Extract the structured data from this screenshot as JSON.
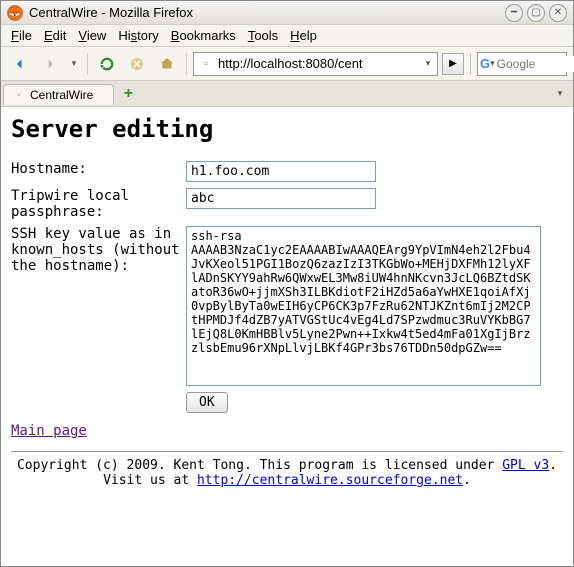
{
  "window": {
    "title": "CentralWire - Mozilla Firefox"
  },
  "menu": {
    "file": "File",
    "edit": "Edit",
    "view": "View",
    "history": "History",
    "bookmarks": "Bookmarks",
    "tools": "Tools",
    "help": "Help"
  },
  "url": {
    "value": "http://localhost:8080/cent"
  },
  "search": {
    "placeholder": "Google"
  },
  "tab": {
    "label": "CentralWire"
  },
  "page": {
    "heading": "Server editing",
    "hostname_label": "Hostname:",
    "hostname_value": "h1.foo.com",
    "passphrase_label": "Tripwire local passphrase:",
    "passphrase_value": "abc",
    "sshkey_label": "SSH key value as in known_hosts (without the hostname):",
    "sshkey_value": "ssh-rsa AAAAB3NzaC1yc2EAAAABIwAAAQEArg9YpVImN4eh2l2Fbu4JvKXeol51PGI1BozQ6zazIzI3TKGbWo+MEHjDXFMh12lyXFlADnSKYY9ahRw6QWxwEL3Mw8iUW4hnNKcvn3JcLQ6BZtdSKatoR36wO+jjmXSh3ILBKdiotF2iHZd5a6aYwHXE1qoiAfXj0vpBylByTa0wEIH6yCP6CK3p7FzRu62NTJKZnt6mIj2M2CPtHPMDJf4dZB7yATVGStUc4vEg4Ld7SPzwdmuc3RuVYKbBG7lEjQ8L0KmHBBlv5Lyne2Pwn++Ixkw4t5ed4mFa01XgIjBrzzlsbEmu96rXNpLlvjLBKf4GPr3bs76TDDn50dpGZw==",
    "ok_label": "OK",
    "mainpage_link": "Main page",
    "copyright_pre": "Copyright (c) 2009. Kent Tong. This program is licensed under ",
    "gpl_link": "GPL v3",
    "copyright_mid": ". Visit us at ",
    "site_link": "http://centralwire.sourceforge.net",
    "copyright_end": "."
  }
}
